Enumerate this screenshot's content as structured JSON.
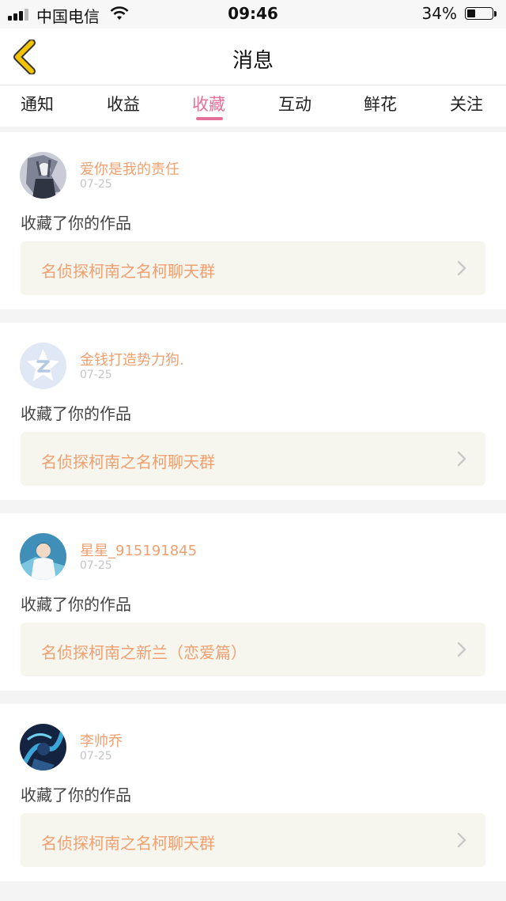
{
  "status_bar": {
    "carrier": "中国电信",
    "time": "09:46",
    "battery_percent": "34%",
    "battery_level": 0.34,
    "icons": [
      "signal-icon",
      "wifi-icon",
      "battery-icon"
    ]
  },
  "nav": {
    "title": "消息",
    "back_icon": "chevron-left-icon",
    "back_color": "#f5c400"
  },
  "tabs": [
    {
      "label": "通知"
    },
    {
      "label": "收益"
    },
    {
      "label": "收藏",
      "active": true
    },
    {
      "label": "互动"
    },
    {
      "label": "鲜花"
    },
    {
      "label": "关注"
    }
  ],
  "accent_color": "#e4709a",
  "name_color": "#f0a070",
  "notifications": [
    {
      "username": "爱你是我的责任",
      "date": "07-25",
      "action": "收藏了你的作品",
      "work_title": "名侦探柯南之名柯聊天群"
    },
    {
      "username": "金钱打造势力狗.",
      "date": "07-25",
      "action": "收藏了你的作品",
      "work_title": "名侦探柯南之名柯聊天群"
    },
    {
      "username": "星星_915191845",
      "date": "07-25",
      "action": "收藏了你的作品",
      "work_title": "名侦探柯南之新兰（恋爱篇）"
    },
    {
      "username": "李帅乔",
      "date": "07-25",
      "action": "收藏了你的作品",
      "work_title": "名侦探柯南之名柯聊天群"
    }
  ]
}
